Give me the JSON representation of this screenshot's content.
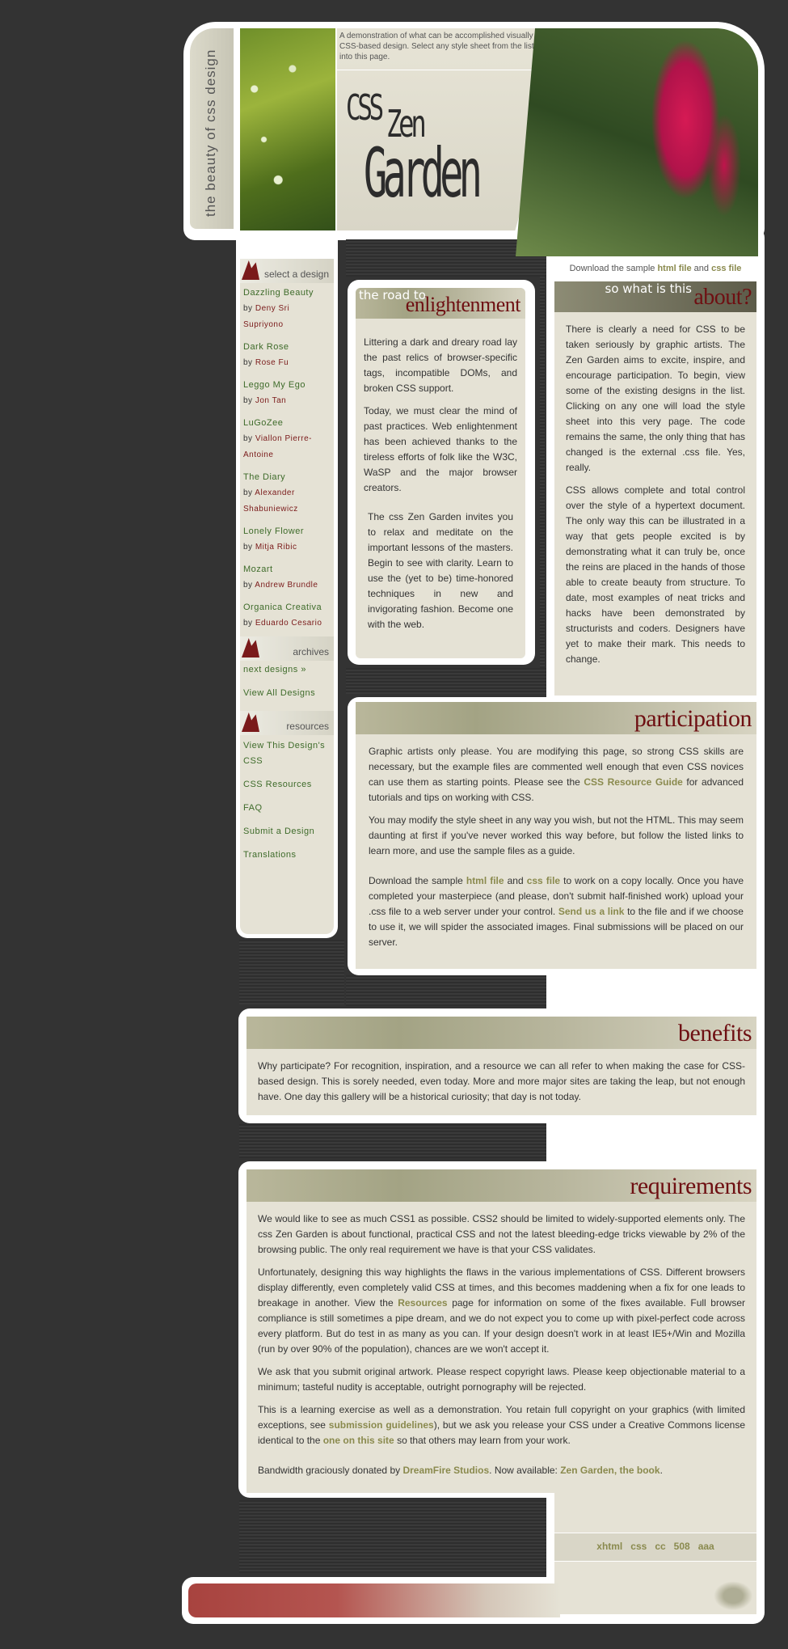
{
  "header": {
    "tagline_vertical": "the beauty of css design",
    "intro": "A demonstration of what can be accomplished visually through CSS-based design. Select any style sheet from the list to load it into this page.",
    "logo_line1": "CSS",
    "logo_line2": "Zen",
    "logo_line3": "Garden",
    "download_prefix": "Download the sample ",
    "html_file": "html file",
    "and": " and ",
    "css_file": "css file"
  },
  "sidebar": {
    "select_title": "select a design",
    "by": "by ",
    "designs": [
      {
        "name": "Dazzling Beauty",
        "author": "Deny Sri Supriyono"
      },
      {
        "name": "Dark Rose",
        "author": "Rose Fu"
      },
      {
        "name": "Leggo My Ego",
        "author": "Jon Tan"
      },
      {
        "name": "LuGoZee",
        "author": "Viallon Pierre-Antoine"
      },
      {
        "name": "The Diary",
        "author": "Alexander Shabuniewicz"
      },
      {
        "name": "Lonely Flower",
        "author": "Mitja Ribic"
      },
      {
        "name": "Mozart",
        "author": "Andrew Brundle"
      },
      {
        "name": "Organica Creativa",
        "author": "Eduardo Cesario"
      }
    ],
    "archives_title": "archives",
    "next_designs": "next designs »",
    "view_all": "View All Designs",
    "resources_title": "resources",
    "resources": [
      "View This Design's CSS",
      "CSS Resources",
      "FAQ",
      "Submit a Design",
      "Translations"
    ]
  },
  "enlightenment": {
    "sub": "the road to",
    "title": "enlightenment",
    "p1": "Littering a dark and dreary road lay the past relics of browser-specific tags, incompatible DOMs, and broken CSS support.",
    "p2": "Today, we must clear the mind of past practices. Web enlightenment has been achieved thanks to the tireless efforts of folk like the W3C, WaSP and the major browser creators.",
    "p3": "The css Zen Garden invites you to relax and meditate on the important lessons of the masters. Begin to see with clarity. Learn to use the (yet to be) time-honored techniques in new and invigorating fashion. Become one with the web."
  },
  "about": {
    "sub": "so what is this",
    "title": "about?",
    "p1": "There is clearly a need for CSS to be taken seriously by graphic artists. The Zen Garden aims to excite, inspire, and encourage participation. To begin, view some of the existing designs in the list. Clicking on any one will load the style sheet into this very page. The code remains the same, the only thing that has changed is the external .css file. Yes, really.",
    "p2": "CSS allows complete and total control over the style of a hypertext document. The only way this can be illustrated in a way that gets people excited is by demonstrating what it can truly be, once the reins are placed in the hands of those able to create beauty from structure. To date, most examples of neat tricks and hacks have been demonstrated by structurists and coders. Designers have yet to make their mark. This needs to change."
  },
  "participation": {
    "title": "participation",
    "p1a": "Graphic artists only please. You are modifying this page, so strong CSS skills are necessary, but the example files are commented well enough that even CSS novices can use them as starting points. Please see the ",
    "p1_link": "CSS Resource Guide",
    "p1b": " for advanced tutorials and tips on working with CSS.",
    "p2": "You may modify the style sheet in any way you wish, but not the HTML. This may seem daunting at first if you've never worked this way before, but follow the listed links to learn more, and use the sample files as a guide.",
    "p3a": "Download the sample ",
    "p3_html": "html file",
    "p3_and": " and ",
    "p3_css": "css file",
    "p3b": " to work on a copy locally. Once you have completed your masterpiece (and please, don't submit half-finished work) upload your .css file to a web server under your control. ",
    "p3_send": "Send us a link",
    "p3c": " to the file and if we choose to use it, we will spider the associated images. Final submissions will be placed on our server."
  },
  "benefits": {
    "title": "benefits",
    "p1": "Why participate? For recognition, inspiration, and a resource we can all refer to when making the case for CSS-based design. This is sorely needed, even today. More and more major sites are taking the leap, but not enough have. One day this gallery will be a historical curiosity; that day is not today."
  },
  "requirements": {
    "title": "requirements",
    "p1": "We would like to see as much CSS1 as possible. CSS2 should be limited to widely-supported elements only. The css Zen Garden is about functional, practical CSS and not the latest bleeding-edge tricks viewable by 2% of the browsing public. The only real requirement we have is that your CSS validates.",
    "p2a": "Unfortunately, designing this way highlights the flaws in the various implementations of CSS. Different browsers display differently, even completely valid CSS at times, and this becomes maddening when a fix for one leads to breakage in another. View the ",
    "p2_link": "Resources",
    "p2b": " page for information on some of the fixes available. Full browser compliance is still sometimes a pipe dream, and we do not expect you to come up with pixel-perfect code across every platform. But do test in as many as you can. If your design doesn't work in at least IE5+/Win and Mozilla (run by over 90% of the population), chances are we won't accept it.",
    "p3": "We ask that you submit original artwork. Please respect copyright laws. Please keep objectionable material to a minimum; tasteful nudity is acceptable, outright pornography will be rejected.",
    "p4a": "This is a learning exercise as well as a demonstration. You retain full copyright on your graphics (with limited exceptions, see ",
    "p4_link1": "submission guidelines",
    "p4b": "), but we ask you release your CSS under a Creative Commons license identical to the ",
    "p4_link2": "one on this site",
    "p4c": " so that others may learn from your work.",
    "p5a": "Bandwidth graciously donated by ",
    "p5_link1": "DreamFire Studios",
    "p5b": ". Now available: ",
    "p5_link2": "Zen Garden, the book",
    "p5c": "."
  },
  "footer": {
    "links": [
      "xhtml",
      "css",
      "cc",
      "508",
      "aaa"
    ]
  }
}
